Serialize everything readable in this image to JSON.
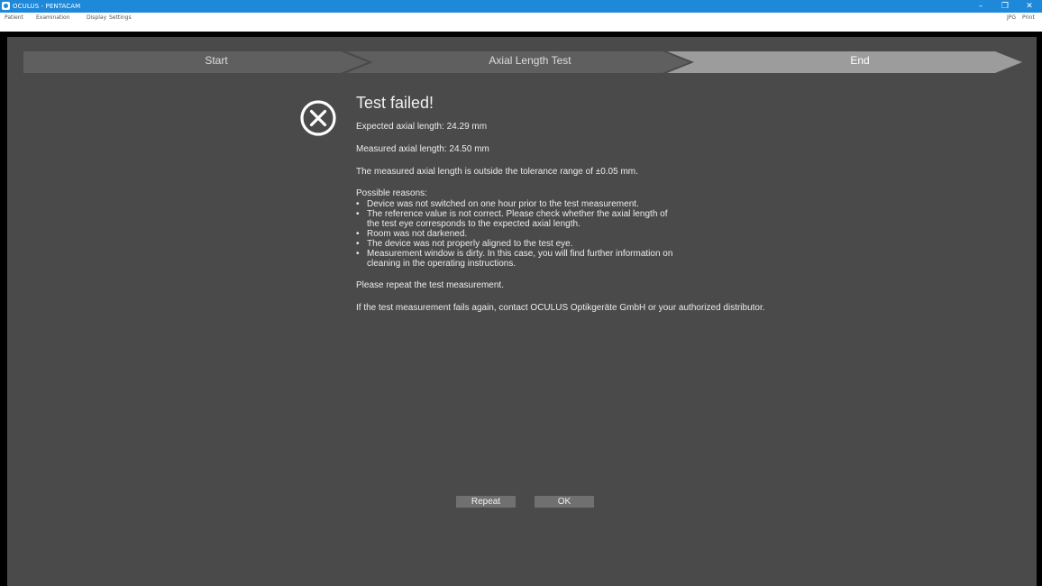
{
  "window": {
    "title": "OCULUS - PENTACAM",
    "minimize": "–",
    "maximize": "❐",
    "close": "✕"
  },
  "menu": {
    "items": [
      "Patient",
      "Examination",
      "Display",
      "Settings"
    ],
    "right_items": [
      "JPG",
      "Print"
    ]
  },
  "steps": [
    {
      "label": "Start",
      "state": "done"
    },
    {
      "label": "Axial Length Test",
      "state": "done"
    },
    {
      "label": "End",
      "state": "active"
    }
  ],
  "colors": {
    "step_dark": "#5f5f5f",
    "step_active": "#9c9c9c",
    "panel": "#4a4a4a",
    "titlebar": "#1e88d9"
  },
  "result": {
    "icon": "x-circle-icon",
    "heading": "Test failed!",
    "expected": "Expected axial length: 24.29 mm",
    "measured": "Measured axial length: 24.50 mm",
    "tolerance": "The measured axial length is outside the tolerance range of ±0.05 mm.",
    "reasons_title": "Possible reasons:",
    "reasons": [
      "Device was not switched on one hour prior to the test measurement.",
      "The reference value is not correct. Please check whether the axial length of\nthe test eye corresponds to the expected axial length.",
      "Room was not darkened.",
      "The device was not properly aligned to the test eye.",
      "Measurement window is dirty. In this case, you will find further information on\ncleaning in the operating instructions."
    ],
    "repeat_note": "Please repeat the test measurement.",
    "contact_note": "If the test measurement fails again, contact OCULUS Optikgeräte GmbH or your authorized distributor."
  },
  "buttons": {
    "repeat": "Repeat",
    "ok": "OK"
  }
}
